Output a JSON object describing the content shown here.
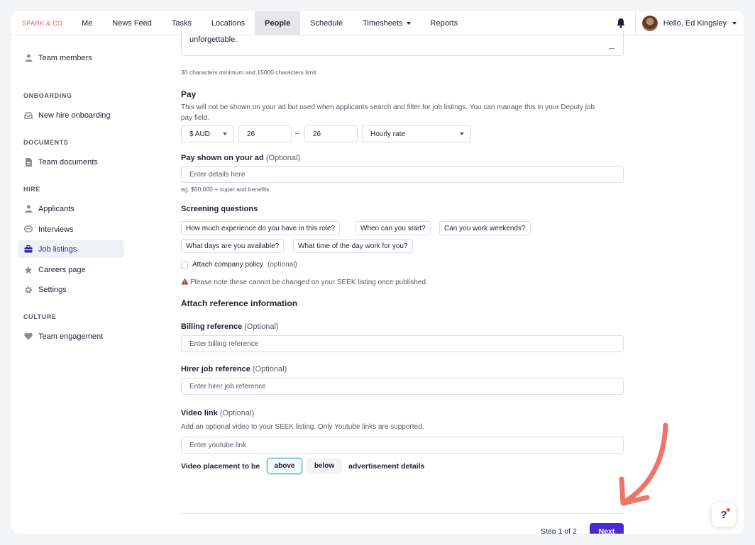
{
  "topbar": {
    "brand": "SPARK & CO",
    "nav": [
      "Me",
      "News Feed",
      "Tasks",
      "Locations",
      "People",
      "Schedule",
      "Timesheets",
      "Reports"
    ],
    "active": "People",
    "greeting": "Hello, Ed Kingsley",
    "icons": {
      "bell": "bell-icon",
      "avatar": "user-avatar"
    }
  },
  "sidebar": {
    "team_members": "Team members",
    "onboarding_header": "ONBOARDING",
    "new_hire_onboarding": "New hire onboarding",
    "documents_header": "DOCUMENTS",
    "team_documents": "Team documents",
    "hire_header": "HIRE",
    "applicants": "Applicants",
    "interviews": "Interviews",
    "job_listings": "Job listings",
    "careers_page": "Careers page",
    "settings": "Settings",
    "culture_header": "CULTURE",
    "team_engagement": "Team engagement"
  },
  "form": {
    "description_tail": "unforgettable.",
    "description_hint": "30 characters minimum and 15000 characters limit",
    "pay": {
      "title": "Pay",
      "description": "This will not be shown on your ad but used when applicants search and filter for job listings. You can manage this in your Deputy job pay field.",
      "currency": "$ AUD",
      "min": "26",
      "separator": "–",
      "max": "26",
      "rate_type": "Hourly rate"
    },
    "pay_shown": {
      "label": "Pay shown on your ad",
      "optional": "(Optional)",
      "placeholder": "Enter details here",
      "hint": "eg. $50,000 + super and benefits"
    },
    "screening": {
      "label": "Screening questions",
      "questions": [
        "How much experience do you have in this role?",
        "When can you start?",
        "Can you work weekends?",
        "What days are you available?",
        "What time of the day work for you?"
      ],
      "attach_policy": "Attach company policy",
      "attach_optional": "(optional)",
      "warning": "Please note these cannot be changed on your SEEK listing once published."
    },
    "reference": {
      "title": "Attach reference information",
      "billing_label": "Billing reference",
      "billing_optional": "(Optional)",
      "billing_placeholder": "Enter billing reference",
      "hirer_label": "Hirer job reference",
      "hirer_optional": "(Optional)",
      "hirer_placeholder": "Enter hirer job reference"
    },
    "video": {
      "label": "Video link",
      "optional": "(Optional)",
      "description": "Add an optional video to your SEEK listing. Only Youtube links are supported.",
      "placeholder": "Enter youtube link",
      "placement_label": "Video placement to be",
      "above": "above",
      "below": "below",
      "suffix": "advertisement details",
      "selected": "above"
    }
  },
  "footer": {
    "step": "Step 1 of 2",
    "next": "Next"
  },
  "help": "?",
  "colors": {
    "brand": "#e8584f",
    "primary": "#4b2bd1",
    "annotation_arrow": "#f07467"
  }
}
